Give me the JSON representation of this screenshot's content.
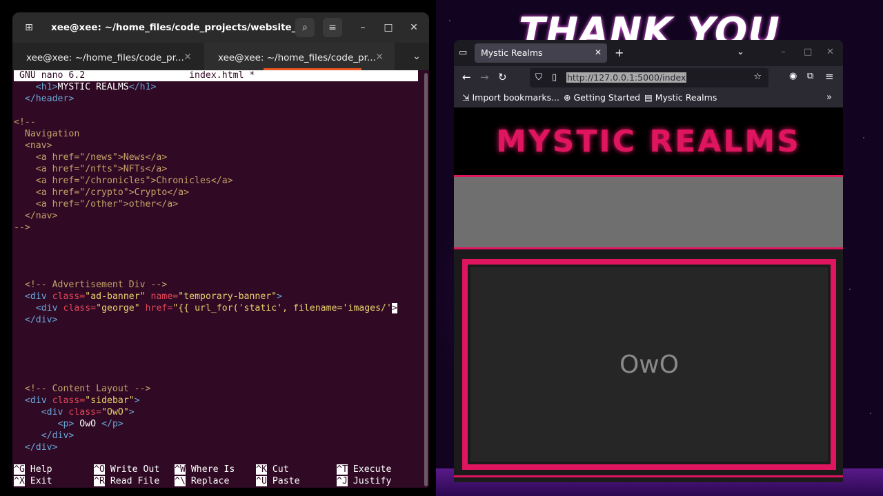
{
  "wallpaper": {
    "text": "THANK YOU"
  },
  "terminal": {
    "window_title": "xee@xee: ~/home_files/code_projects/website_...",
    "tabs": [
      {
        "label": "xee@xee: ~/home_files/code_pr..."
      },
      {
        "label": "xee@xee: ~/home_files/code_pr..."
      }
    ],
    "nano_version": "GNU nano 6.2",
    "filename": "index.html *",
    "shortcuts": [
      {
        "key": "^G",
        "label": "Help"
      },
      {
        "key": "^O",
        "label": "Write Out"
      },
      {
        "key": "^W",
        "label": "Where Is"
      },
      {
        "key": "^K",
        "label": "Cut"
      },
      {
        "key": "^T",
        "label": "Execute"
      },
      {
        "key": "^X",
        "label": "Exit"
      },
      {
        "key": "^R",
        "label": "Read File"
      },
      {
        "key": "^\\",
        "label": "Replace"
      },
      {
        "key": "^U",
        "label": "Paste"
      },
      {
        "key": "^J",
        "label": "Justify"
      }
    ]
  },
  "browser": {
    "tab_title": "Mystic Realms",
    "url": "http://127.0.0.1:5000/index",
    "bookmarks": [
      "Import bookmarks...",
      "Getting Started",
      "Mystic Realms"
    ],
    "page": {
      "heading": "MYSTIC REALMS",
      "sidebar_text": "OwO"
    },
    "accent": "#e0155f"
  }
}
